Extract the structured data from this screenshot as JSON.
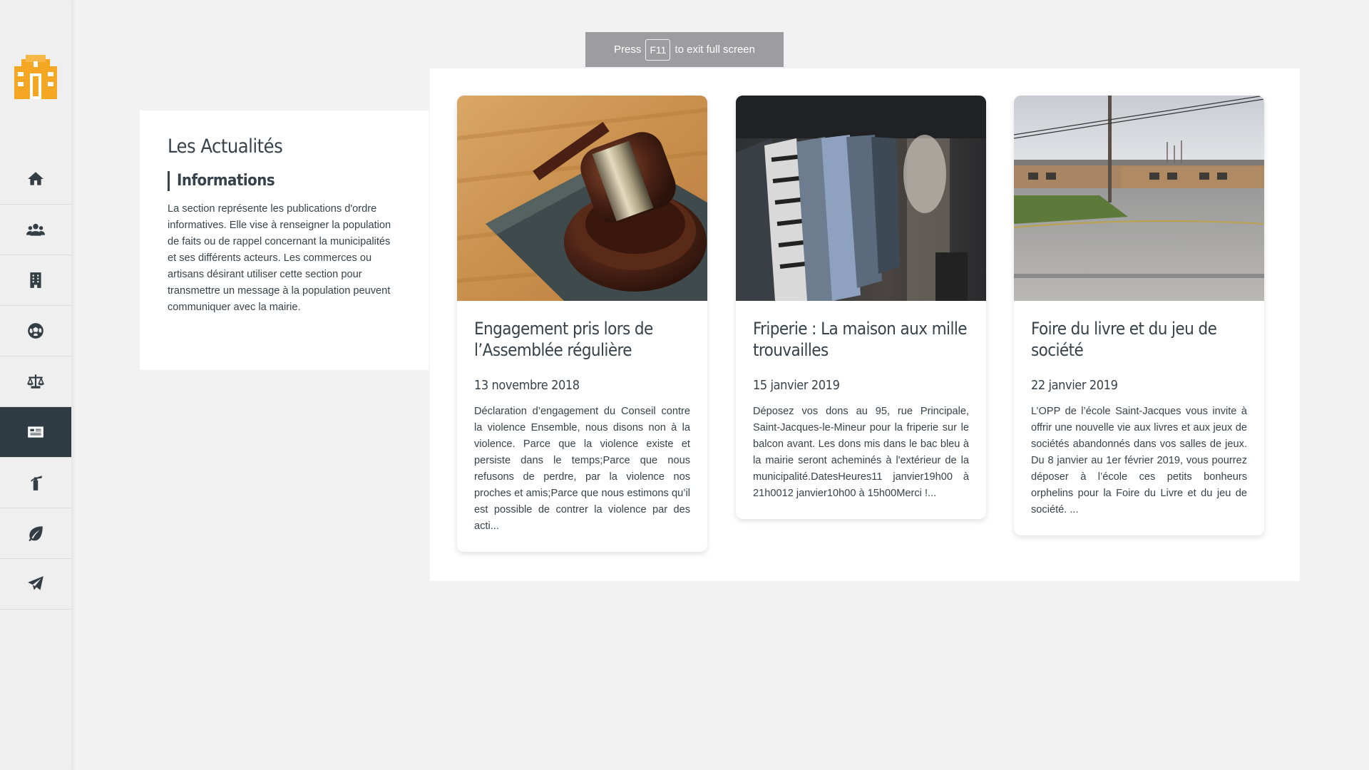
{
  "fullscreen_notice": {
    "before": "Press",
    "key": "F11",
    "after": "to exit full screen"
  },
  "brand": {
    "accent": "#f5a623",
    "sidebar_active": "#2e3b42"
  },
  "sidebar": {
    "items": [
      {
        "icon": "home-icon"
      },
      {
        "icon": "users-icon"
      },
      {
        "icon": "building-icon"
      },
      {
        "icon": "soccer-ball-icon"
      },
      {
        "icon": "balance-scale-icon"
      },
      {
        "icon": "newspaper-icon",
        "active": true
      },
      {
        "icon": "fire-extinguisher-icon"
      },
      {
        "icon": "leaf-icon"
      },
      {
        "icon": "paper-plane-icon"
      }
    ]
  },
  "info": {
    "title": "Les Actualités",
    "subtitle": "Informations",
    "text": "La section représente les publications d'ordre informatives. Elle vise à renseigner la population de faits ou de rappel concernant la municipalités et ses différents acteurs. Les commerces ou artisans désirant utiliser cette section pour transmettre un message à la population peuvent communiquer avec la mairie."
  },
  "cards": [
    {
      "title": "Engagement pris lors de l’Assemblée régulière",
      "date": "13 novembre 2018",
      "excerpt": "Déclaration d’engagement du Conseil contre la violence Ensemble, nous disons non à la violence. Parce que la violence existe et persiste dans le temps;Parce que nous refusons de perdre, par la violence nos proches et amis;Parce que nous estimons qu’il est possible de contrer la violence par des acti..."
    },
    {
      "title": "Friperie : La maison aux mille trouvailles",
      "date": "15 janvier 2019",
      "excerpt": "Déposez vos dons au 95, rue Principale, Saint-Jacques-le-Mineur pour la friperie sur le balcon avant. Les dons mis dans le bac bleu à la mairie seront acheminés à l'extérieur de la municipalité.DatesHeures11 janvier19h00 à 21h0012 janvier10h00 à 15h00Merci !..."
    },
    {
      "title": "Foire du livre et du jeu de société",
      "date": "22 janvier 2019",
      "excerpt": "L’OPP de l’école Saint-Jacques vous invite à offrir une nouvelle vie aux livres et aux jeux de sociétés abandonnés dans vos salles de jeux. Du 8 janvier au 1er février 2019, vous pourrez déposer à l’école ces petits bonheurs orphelins pour la Foire du Livre et du jeu de société. ..."
    }
  ]
}
